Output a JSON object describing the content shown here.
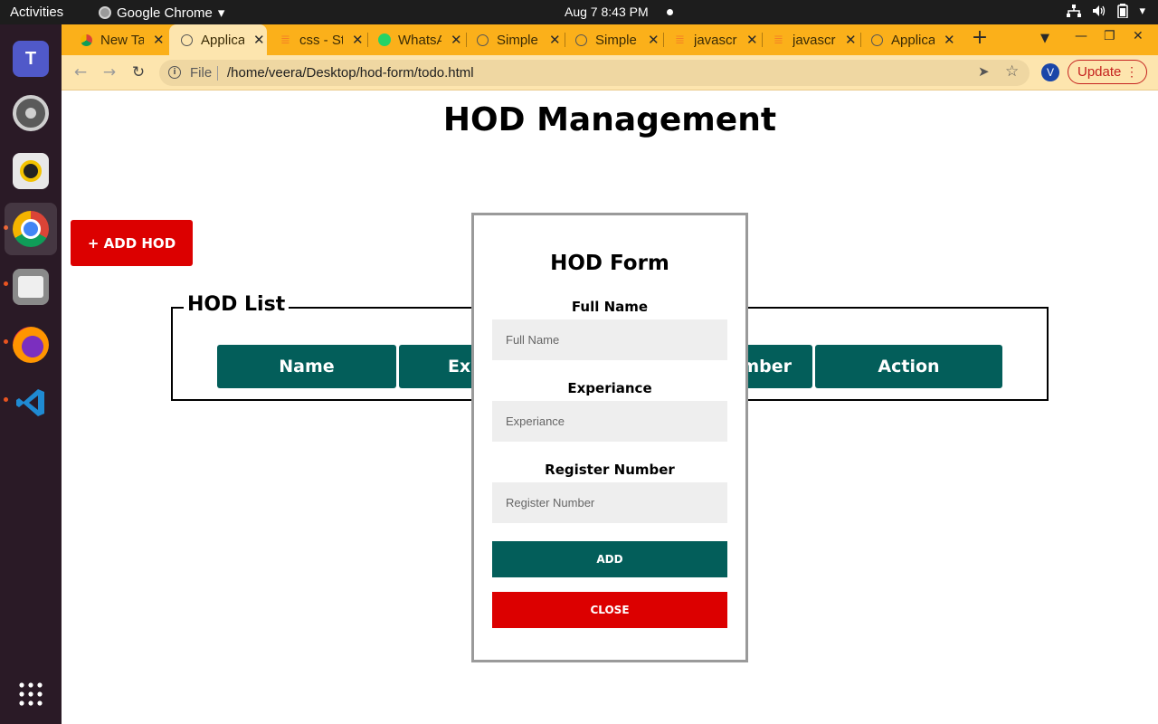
{
  "system_bar": {
    "activities": "Activities",
    "app_name": "Google Chrome",
    "clock": "Aug 7  8:43 PM"
  },
  "dock": {
    "items": [
      {
        "name": "teams-icon"
      },
      {
        "name": "settings-icon"
      },
      {
        "name": "rhythmbox-icon"
      },
      {
        "name": "chrome-icon"
      },
      {
        "name": "files-icon"
      },
      {
        "name": "firefox-icon"
      },
      {
        "name": "vscode-icon"
      }
    ]
  },
  "browser": {
    "tabs": [
      {
        "label": "New Tab",
        "icon": "chrome-icon",
        "active": false
      },
      {
        "label": "Application",
        "icon": "globe-icon",
        "active": true
      },
      {
        "label": "css - Stack Overflow",
        "icon": "stackoverflow-icon",
        "active": false
      },
      {
        "label": "WhatsApp",
        "icon": "whatsapp-icon",
        "active": false
      },
      {
        "label": "Simple",
        "icon": "globe-icon",
        "active": false
      },
      {
        "label": "Simple",
        "icon": "globe-icon",
        "active": false
      },
      {
        "label": "javascript",
        "icon": "stackoverflow-icon",
        "active": false
      },
      {
        "label": "javascript",
        "icon": "stackoverflow-icon",
        "active": false
      },
      {
        "label": "Application",
        "icon": "globe-icon",
        "active": false
      }
    ],
    "address": {
      "protocol": "File",
      "url": "/home/veera/Desktop/hod-form/todo.html"
    },
    "profile_initial": "V",
    "update_label": "Update",
    "accent_color": "#fbb01a"
  },
  "page": {
    "title": "HOD Management",
    "add_button": "+ ADD HOD",
    "list_legend": "HOD List",
    "columns": [
      "Name",
      "Experiance",
      "Register Number",
      "Action"
    ],
    "colors": {
      "primary": "#035e5a",
      "danger": "#dc0000"
    }
  },
  "modal": {
    "title": "HOD Form",
    "fields": [
      {
        "label": "Full Name",
        "placeholder": "Full Name",
        "value": ""
      },
      {
        "label": "Experiance",
        "placeholder": "Experiance",
        "value": ""
      },
      {
        "label": "Register Number",
        "placeholder": "Register Number",
        "value": ""
      }
    ],
    "add_button": "ADD",
    "close_button": "CLOSE"
  }
}
